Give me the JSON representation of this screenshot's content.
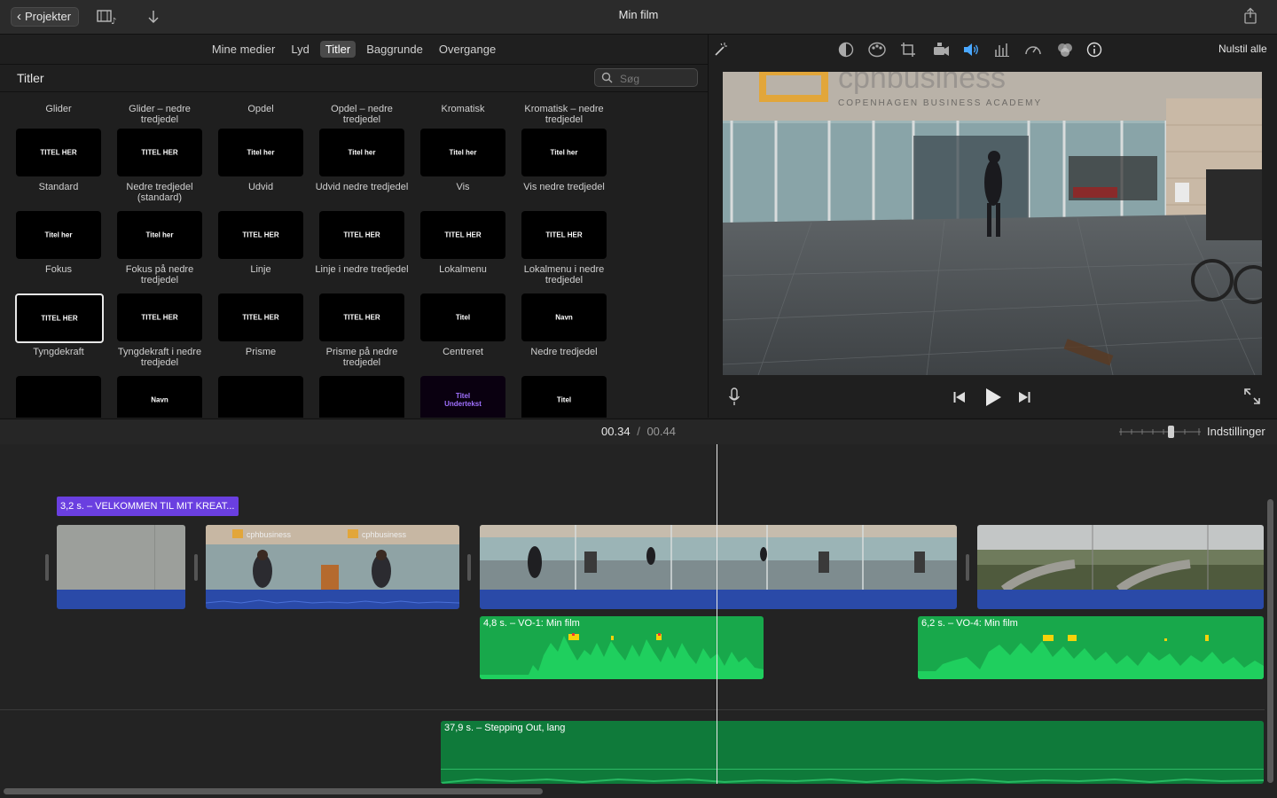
{
  "toolbar": {
    "back_label": "Projekter",
    "title": "Min film"
  },
  "browser": {
    "tabs": [
      {
        "label": "Mine medier",
        "active": false
      },
      {
        "label": "Lyd",
        "active": false
      },
      {
        "label": "Titler",
        "active": true
      },
      {
        "label": "Baggrunde",
        "active": false
      },
      {
        "label": "Overgange",
        "active": false
      }
    ],
    "section_title": "Titler",
    "search_placeholder": "Søg",
    "rows": [
      [
        {
          "label": "Glider",
          "thumb": ""
        },
        {
          "label": "Glider – nedre tredjedel",
          "thumb": ""
        },
        {
          "label": "Opdel",
          "thumb": ""
        },
        {
          "label": "Opdel – nedre tredjedel",
          "thumb": ""
        },
        {
          "label": "Kromatisk",
          "thumb": ""
        },
        {
          "label": "Kromatisk – nedre tredjedel",
          "thumb": ""
        }
      ],
      [
        {
          "label": "Standard",
          "thumb": "TITEL HER"
        },
        {
          "label": "Nedre tredjedel (standard)",
          "thumb": "TITEL HER"
        },
        {
          "label": "Udvid",
          "thumb": "Titel her"
        },
        {
          "label": "Udvid nedre tredjedel",
          "thumb": "Titel her"
        },
        {
          "label": "Vis",
          "thumb": "Titel her"
        },
        {
          "label": "Vis nedre tredjedel",
          "thumb": "Titel her"
        }
      ],
      [
        {
          "label": "Fokus",
          "thumb": "Titel her"
        },
        {
          "label": "Fokus på nedre tredjedel",
          "thumb": "Titel her"
        },
        {
          "label": "Linje",
          "thumb": "TITEL HER"
        },
        {
          "label": "Linje i nedre tredjedel",
          "thumb": "TITEL HER"
        },
        {
          "label": "Lokalmenu",
          "thumb": "TITEL HER"
        },
        {
          "label": "Lokalmenu i nedre tredjedel",
          "thumb": "TITEL HER"
        }
      ],
      [
        {
          "label": "Tyngdekraft",
          "thumb": "TITEL HER",
          "selected": true
        },
        {
          "label": "Tyngdekraft i nedre tredjedel",
          "thumb": "TITEL HER"
        },
        {
          "label": "Prisme",
          "thumb": "TITEL HER"
        },
        {
          "label": "Prisme på nedre tredjedel",
          "thumb": "TITEL HER"
        },
        {
          "label": "Centreret",
          "thumb": "Titel"
        },
        {
          "label": "Nedre tredjedel",
          "thumb": "Navn"
        }
      ],
      [
        {
          "label": "",
          "thumb": ""
        },
        {
          "label": "",
          "thumb": "Navn"
        },
        {
          "label": "",
          "thumb": ""
        },
        {
          "label": "",
          "thumb": ""
        },
        {
          "label": "",
          "thumb": "Titel\nUndertekst"
        },
        {
          "label": "",
          "thumb": "Titel"
        }
      ]
    ]
  },
  "viewer": {
    "reset_all": "Nulstil alle",
    "adjust_icons": [
      "magic-wand-icon",
      "color-balance-icon",
      "color-correction-icon",
      "crop-icon",
      "stabilization-icon",
      "volume-icon",
      "noise-reduction-icon",
      "speed-icon",
      "filter-icon",
      "info-icon"
    ],
    "sign_text": "cphbusiness",
    "sign_subtext": "COPENHAGEN BUSINESS ACADEMY"
  },
  "timeline": {
    "current_time": "00.34",
    "separator": "/",
    "total_time": "00.44",
    "settings_label": "Indstillinger",
    "title_clip": "3,2 s. – VELKOMMEN TIL MIT KREAT...",
    "audio_clips": [
      {
        "label": "4,8 s. – VO-1: Min film"
      },
      {
        "label": "6,2 s. – VO-4: Min film"
      }
    ],
    "music_clip": "37,9 s. – Stepping Out, lang"
  },
  "colors": {
    "title_clip": "#6a3fe0",
    "audio": "#18a84b",
    "music": "#0f7a3a",
    "video_audio_strip": "#2a4aa8",
    "accent": "#4aa8ff"
  }
}
